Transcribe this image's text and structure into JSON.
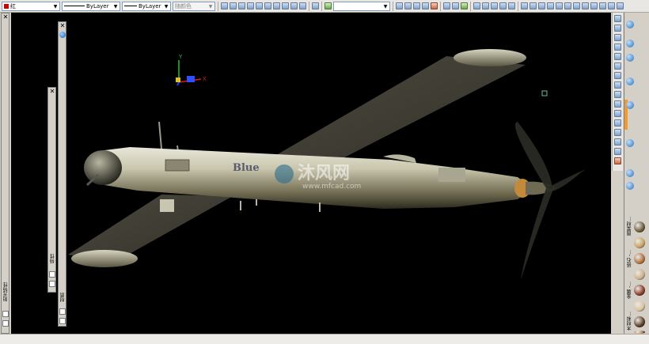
{
  "toolbar": {
    "color_value": "红",
    "linetype_value": "ByLayer",
    "lineweight_value": "ByLayer",
    "plotstyle_value": "随颜色"
  },
  "viewport": {
    "ucs_axes": {
      "x": "X",
      "y": "Y"
    },
    "model_text": "Blue",
    "watermark_cn": "沐风网",
    "watermark_url": "www.mfcad.com"
  },
  "left_palettes": {
    "palette1_title": "阳光特性",
    "palette2_title": "特性",
    "palette3_title": "材质"
  },
  "right_panel": {
    "material_tabs": [
      "图案材...",
      "砖石 -...",
      "金属 -...",
      "木材和..."
    ],
    "material_colors": [
      "#6b5a3a",
      "#c8a060",
      "#b07040",
      "#c9b08a",
      "#8a3a28",
      "#d9c29a",
      "#5a3b22",
      "#b5895a"
    ]
  },
  "statusbar": {
    "text": ""
  }
}
